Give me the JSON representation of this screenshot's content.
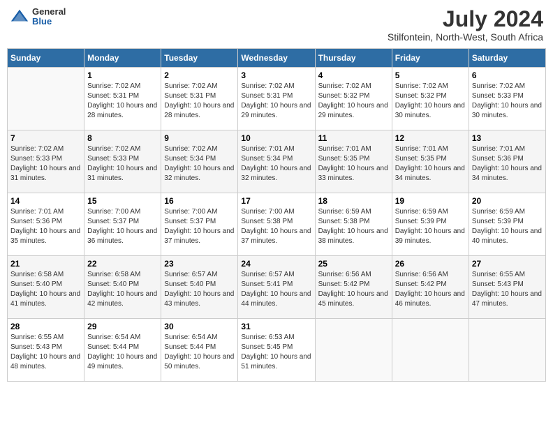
{
  "header": {
    "logo_general": "General",
    "logo_blue": "Blue",
    "month_title": "July 2024",
    "location": "Stilfontein, North-West, South Africa"
  },
  "days_of_week": [
    "Sunday",
    "Monday",
    "Tuesday",
    "Wednesday",
    "Thursday",
    "Friday",
    "Saturday"
  ],
  "weeks": [
    [
      {
        "day": "",
        "sunrise": "",
        "sunset": "",
        "daylight": ""
      },
      {
        "day": "1",
        "sunrise": "Sunrise: 7:02 AM",
        "sunset": "Sunset: 5:31 PM",
        "daylight": "Daylight: 10 hours and 28 minutes."
      },
      {
        "day": "2",
        "sunrise": "Sunrise: 7:02 AM",
        "sunset": "Sunset: 5:31 PM",
        "daylight": "Daylight: 10 hours and 28 minutes."
      },
      {
        "day": "3",
        "sunrise": "Sunrise: 7:02 AM",
        "sunset": "Sunset: 5:31 PM",
        "daylight": "Daylight: 10 hours and 29 minutes."
      },
      {
        "day": "4",
        "sunrise": "Sunrise: 7:02 AM",
        "sunset": "Sunset: 5:32 PM",
        "daylight": "Daylight: 10 hours and 29 minutes."
      },
      {
        "day": "5",
        "sunrise": "Sunrise: 7:02 AM",
        "sunset": "Sunset: 5:32 PM",
        "daylight": "Daylight: 10 hours and 30 minutes."
      },
      {
        "day": "6",
        "sunrise": "Sunrise: 7:02 AM",
        "sunset": "Sunset: 5:33 PM",
        "daylight": "Daylight: 10 hours and 30 minutes."
      }
    ],
    [
      {
        "day": "7",
        "sunrise": "Sunrise: 7:02 AM",
        "sunset": "Sunset: 5:33 PM",
        "daylight": "Daylight: 10 hours and 31 minutes."
      },
      {
        "day": "8",
        "sunrise": "Sunrise: 7:02 AM",
        "sunset": "Sunset: 5:33 PM",
        "daylight": "Daylight: 10 hours and 31 minutes."
      },
      {
        "day": "9",
        "sunrise": "Sunrise: 7:02 AM",
        "sunset": "Sunset: 5:34 PM",
        "daylight": "Daylight: 10 hours and 32 minutes."
      },
      {
        "day": "10",
        "sunrise": "Sunrise: 7:01 AM",
        "sunset": "Sunset: 5:34 PM",
        "daylight": "Daylight: 10 hours and 32 minutes."
      },
      {
        "day": "11",
        "sunrise": "Sunrise: 7:01 AM",
        "sunset": "Sunset: 5:35 PM",
        "daylight": "Daylight: 10 hours and 33 minutes."
      },
      {
        "day": "12",
        "sunrise": "Sunrise: 7:01 AM",
        "sunset": "Sunset: 5:35 PM",
        "daylight": "Daylight: 10 hours and 34 minutes."
      },
      {
        "day": "13",
        "sunrise": "Sunrise: 7:01 AM",
        "sunset": "Sunset: 5:36 PM",
        "daylight": "Daylight: 10 hours and 34 minutes."
      }
    ],
    [
      {
        "day": "14",
        "sunrise": "Sunrise: 7:01 AM",
        "sunset": "Sunset: 5:36 PM",
        "daylight": "Daylight: 10 hours and 35 minutes."
      },
      {
        "day": "15",
        "sunrise": "Sunrise: 7:00 AM",
        "sunset": "Sunset: 5:37 PM",
        "daylight": "Daylight: 10 hours and 36 minutes."
      },
      {
        "day": "16",
        "sunrise": "Sunrise: 7:00 AM",
        "sunset": "Sunset: 5:37 PM",
        "daylight": "Daylight: 10 hours and 37 minutes."
      },
      {
        "day": "17",
        "sunrise": "Sunrise: 7:00 AM",
        "sunset": "Sunset: 5:38 PM",
        "daylight": "Daylight: 10 hours and 37 minutes."
      },
      {
        "day": "18",
        "sunrise": "Sunrise: 6:59 AM",
        "sunset": "Sunset: 5:38 PM",
        "daylight": "Daylight: 10 hours and 38 minutes."
      },
      {
        "day": "19",
        "sunrise": "Sunrise: 6:59 AM",
        "sunset": "Sunset: 5:39 PM",
        "daylight": "Daylight: 10 hours and 39 minutes."
      },
      {
        "day": "20",
        "sunrise": "Sunrise: 6:59 AM",
        "sunset": "Sunset: 5:39 PM",
        "daylight": "Daylight: 10 hours and 40 minutes."
      }
    ],
    [
      {
        "day": "21",
        "sunrise": "Sunrise: 6:58 AM",
        "sunset": "Sunset: 5:40 PM",
        "daylight": "Daylight: 10 hours and 41 minutes."
      },
      {
        "day": "22",
        "sunrise": "Sunrise: 6:58 AM",
        "sunset": "Sunset: 5:40 PM",
        "daylight": "Daylight: 10 hours and 42 minutes."
      },
      {
        "day": "23",
        "sunrise": "Sunrise: 6:57 AM",
        "sunset": "Sunset: 5:40 PM",
        "daylight": "Daylight: 10 hours and 43 minutes."
      },
      {
        "day": "24",
        "sunrise": "Sunrise: 6:57 AM",
        "sunset": "Sunset: 5:41 PM",
        "daylight": "Daylight: 10 hours and 44 minutes."
      },
      {
        "day": "25",
        "sunrise": "Sunrise: 6:56 AM",
        "sunset": "Sunset: 5:42 PM",
        "daylight": "Daylight: 10 hours and 45 minutes."
      },
      {
        "day": "26",
        "sunrise": "Sunrise: 6:56 AM",
        "sunset": "Sunset: 5:42 PM",
        "daylight": "Daylight: 10 hours and 46 minutes."
      },
      {
        "day": "27",
        "sunrise": "Sunrise: 6:55 AM",
        "sunset": "Sunset: 5:43 PM",
        "daylight": "Daylight: 10 hours and 47 minutes."
      }
    ],
    [
      {
        "day": "28",
        "sunrise": "Sunrise: 6:55 AM",
        "sunset": "Sunset: 5:43 PM",
        "daylight": "Daylight: 10 hours and 48 minutes."
      },
      {
        "day": "29",
        "sunrise": "Sunrise: 6:54 AM",
        "sunset": "Sunset: 5:44 PM",
        "daylight": "Daylight: 10 hours and 49 minutes."
      },
      {
        "day": "30",
        "sunrise": "Sunrise: 6:54 AM",
        "sunset": "Sunset: 5:44 PM",
        "daylight": "Daylight: 10 hours and 50 minutes."
      },
      {
        "day": "31",
        "sunrise": "Sunrise: 6:53 AM",
        "sunset": "Sunset: 5:45 PM",
        "daylight": "Daylight: 10 hours and 51 minutes."
      },
      {
        "day": "",
        "sunrise": "",
        "sunset": "",
        "daylight": ""
      },
      {
        "day": "",
        "sunrise": "",
        "sunset": "",
        "daylight": ""
      },
      {
        "day": "",
        "sunrise": "",
        "sunset": "",
        "daylight": ""
      }
    ]
  ]
}
